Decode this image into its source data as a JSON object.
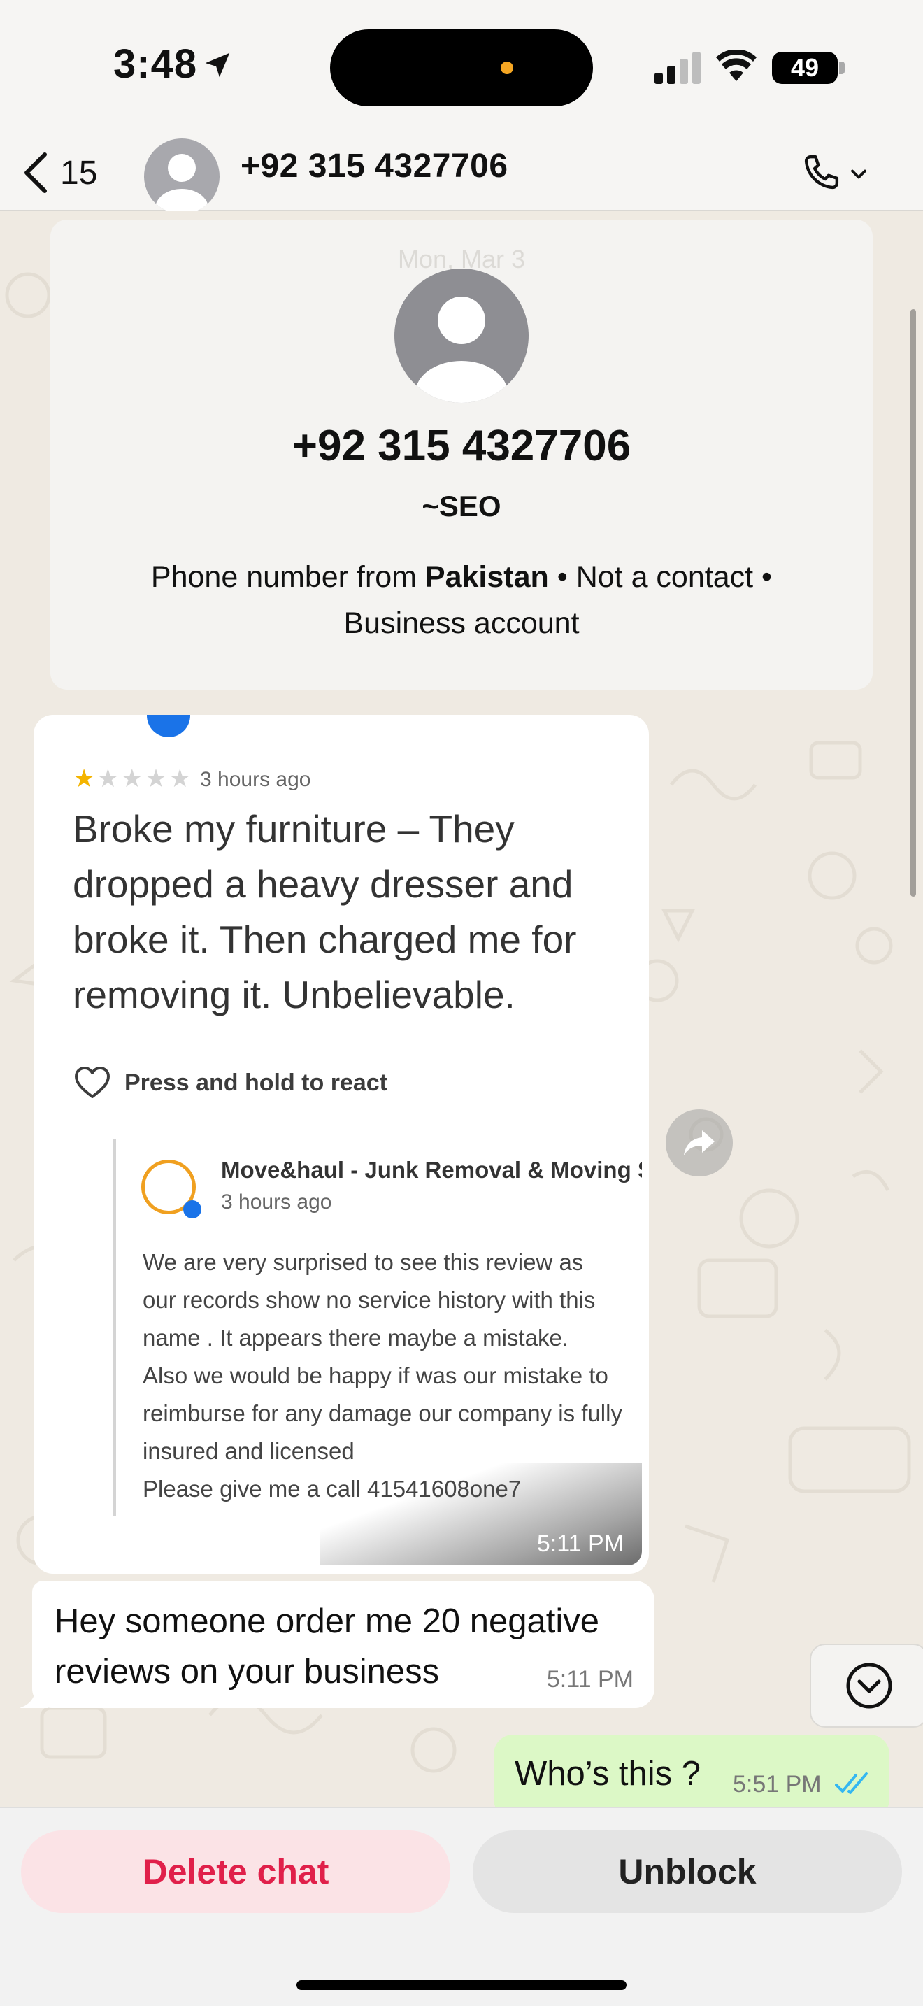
{
  "status_bar": {
    "time": "3:48",
    "battery": "49"
  },
  "header": {
    "back_count": "15",
    "title": "+92 315 4327706"
  },
  "info_card": {
    "date": "Mon, Mar 3",
    "phone": "+92 315 4327706",
    "name": "~SEO",
    "desc_prefix": "Phone number from ",
    "country": "Pakistan",
    "desc_suffix": " • Not a contact • Business account"
  },
  "review_image": {
    "rating_stars": 1,
    "rating_max": 5,
    "review_time": "3 hours ago",
    "review_text": "Broke my furniture – They dropped a heavy dresser and broke it. Then charged me for removing it. Unbelievable.",
    "react_label": "Press and hold to react",
    "business_name": "Move&haul - Junk Removal & Moving S...",
    "business_time": "3 hours ago",
    "business_reply": "We are very surprised to see this review as\nour records show no service history with this\nname . It appears there maybe a mistake.\nAlso we would be happy if was our mistake to\nreimburse for any damage our company is fully\ninsured and licensed\nPlease give me a call 41541608one7",
    "message_time": "5:11 PM"
  },
  "messages": [
    {
      "direction": "incoming",
      "text": "Hey someone order me 20 negative reviews on your business",
      "time": "5:11 PM"
    },
    {
      "direction": "outgoing",
      "text": "Who’s this ?",
      "time": "5:51 PM",
      "status": "read"
    }
  ],
  "actions": {
    "delete_label": "Delete chat",
    "unblock_label": "Unblock"
  },
  "colors": {
    "accent_red": "#e0204a",
    "outgoing_bubble": "#dcf8c6",
    "read_ticks": "#34b7f1",
    "star": "#f4b400"
  },
  "icons": [
    "location-arrow-icon",
    "signal-icon",
    "wifi-icon",
    "back-chevron-icon",
    "phone-icon",
    "chevron-down-icon",
    "heart-icon",
    "forward-icon",
    "scroll-down-icon",
    "double-check-icon"
  ]
}
